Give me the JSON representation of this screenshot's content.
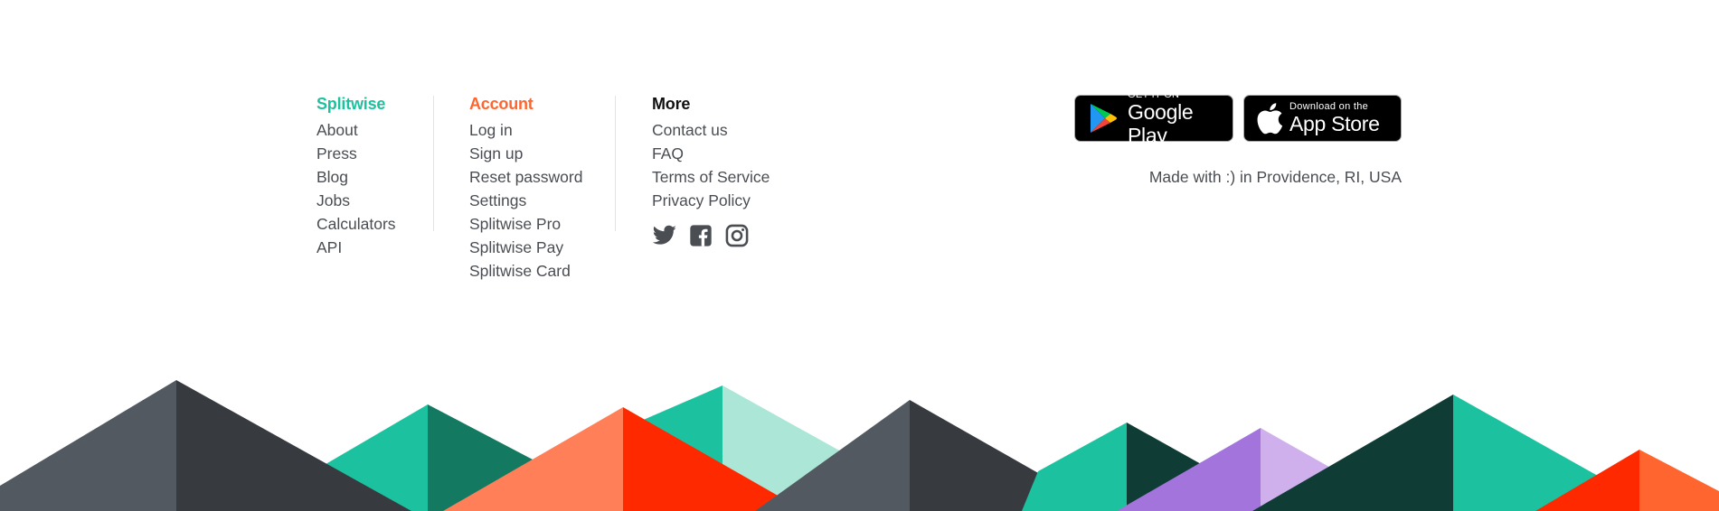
{
  "columns": {
    "splitwise": {
      "heading": "Splitwise",
      "links": [
        "About",
        "Press",
        "Blog",
        "Jobs",
        "Calculators",
        "API"
      ]
    },
    "account": {
      "heading": "Account",
      "links": [
        "Log in",
        "Sign up",
        "Reset password",
        "Settings",
        "Splitwise Pro",
        "Splitwise Pay",
        "Splitwise Card"
      ]
    },
    "more": {
      "heading": "More",
      "links": [
        "Contact us",
        "FAQ",
        "Terms of Service",
        "Privacy Policy"
      ]
    }
  },
  "social": [
    "twitter-icon",
    "facebook-icon",
    "instagram-icon"
  ],
  "badges": {
    "google": {
      "small": "GET IT ON",
      "big": "Google Play"
    },
    "apple": {
      "small": "Download on the",
      "big": "App Store"
    }
  },
  "made_with": "Made with :) in Providence, RI, USA",
  "colors": {
    "brand_green": "#1cc29f",
    "brand_orange": "#ff652f",
    "text": "#4a4e53"
  }
}
